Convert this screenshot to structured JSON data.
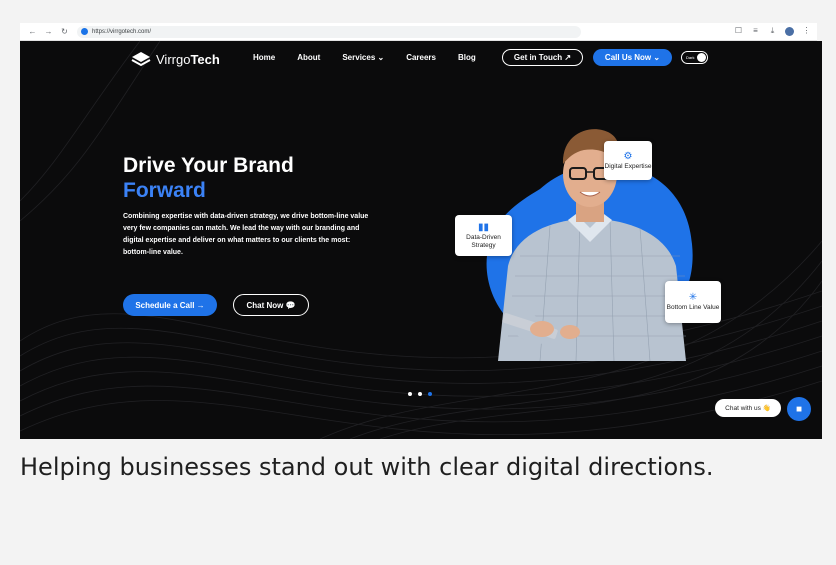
{
  "browser": {
    "url": "https://virrgotech.com/",
    "nav_icons": [
      "back-icon",
      "forward-icon",
      "reload-icon"
    ],
    "right_icons": [
      "bookmark-icon",
      "tab-search-icon",
      "download-icon",
      "profile-avatar",
      "menu-dots-icon"
    ]
  },
  "header": {
    "logo_light": "Virrgo",
    "logo_bold": "Tech",
    "nav": [
      "Home",
      "About",
      "Services ⌄",
      "Careers",
      "Blog"
    ],
    "get_in_touch": "Get in Touch ↗",
    "call_us": "Call Us Now ⌄",
    "theme_label": "Dark"
  },
  "hero": {
    "title_line1": "Drive Your Brand",
    "title_line2": "Forward",
    "description": "Combining expertise with data-driven strategy, we drive bottom-line value very few companies can match. We lead the way with our branding and digital expertise and deliver on what matters to our clients the most: bottom-line value.",
    "schedule_button": "Schedule a Call →",
    "chat_button": "Chat Now 💬",
    "cards": {
      "digital": "Digital Expertise",
      "data": "Data-Driven Strategy",
      "bottom": "Bottom Line Value"
    },
    "carousel": {
      "total": 3,
      "active": 3
    }
  },
  "chat_widget": {
    "label": "Chat with us 👋"
  },
  "caption": "Helping businesses stand out with clear digital directions.",
  "colors": {
    "accent": "#1f73e8",
    "background": "#0b0b0c",
    "headline_blue": "#3b82f6"
  }
}
